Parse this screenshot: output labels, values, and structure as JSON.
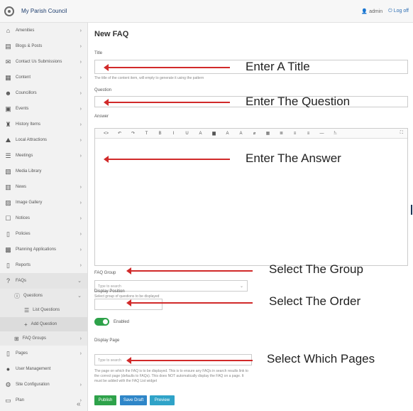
{
  "header": {
    "site_title": "My Parish Council",
    "user_label": "admin",
    "logout_label": "Log off"
  },
  "sidebar": {
    "items": [
      {
        "label": "Amenities",
        "icon": "amenities-icon"
      },
      {
        "label": "Blogs & Posts",
        "icon": "blog-icon"
      },
      {
        "label": "Contact Us Submissions",
        "icon": "mail-icon"
      },
      {
        "label": "Content",
        "icon": "content-icon"
      },
      {
        "label": "Councillors",
        "icon": "people-icon"
      },
      {
        "label": "Events",
        "icon": "calendar-icon"
      },
      {
        "label": "History Items",
        "icon": "history-icon"
      },
      {
        "label": "Local Attractions",
        "icon": "attractions-icon"
      },
      {
        "label": "Meetings",
        "icon": "meetings-icon"
      },
      {
        "label": "Media Library",
        "icon": "media-icon"
      },
      {
        "label": "News",
        "icon": "news-icon"
      },
      {
        "label": "Image Gallery",
        "icon": "gallery-icon"
      },
      {
        "label": "Notices",
        "icon": "notices-icon"
      },
      {
        "label": "Policies",
        "icon": "policies-icon"
      },
      {
        "label": "Planning Applications",
        "icon": "planning-icon"
      },
      {
        "label": "Reports",
        "icon": "reports-icon"
      }
    ],
    "faqs": {
      "label": "FAQs",
      "icon": "question-icon"
    },
    "questions": {
      "label": "Questions",
      "icon": "info-icon"
    },
    "list_questions": {
      "label": "List Questions",
      "icon": "list-icon"
    },
    "add_question": {
      "label": "Add Question",
      "icon": "plus-icon"
    },
    "faq_groups": {
      "label": "FAQ Groups",
      "icon": "groups-icon"
    },
    "bottom_items": [
      {
        "label": "Pages",
        "icon": "pages-icon"
      },
      {
        "label": "User Management",
        "icon": "user-icon"
      },
      {
        "label": "Site Configuration",
        "icon": "config-icon"
      },
      {
        "label": "Plan",
        "icon": "plan-icon"
      }
    ],
    "collapse_label": "«"
  },
  "form": {
    "page_title": "New FAQ",
    "title_label": "Title",
    "title_help": "The title of the content item, will empty to generate it using the pattern",
    "question_label": "Question",
    "answer_label": "Answer",
    "toolbar": [
      "<>",
      "↶",
      "↷",
      "T",
      "B",
      "I",
      "U",
      "A",
      "▆",
      "A",
      "A",
      "⌀",
      "▦",
      "≣",
      "≡",
      "≡",
      "—",
      "⎁"
    ],
    "toolbar_expand": "⛶",
    "faq_group_label": "FAQ Group",
    "faq_group_placeholder": "Type to search",
    "faq_group_help": "Select group of questions to be displayed",
    "display_position_label": "Display Position",
    "enabled_label": "Enabled",
    "display_page_label": "Display Page",
    "display_page_placeholder": "Type to search",
    "display_page_help": "The page on which the FAQ is to be displayed. This is to ensure any FAQs in search results link to the correct page (defaults to FAQs). This does NOT automatically display the FAQ on a page. It must be added with the FAQ List widget",
    "publish_label": "Publish",
    "save_draft_label": "Save Draft",
    "preview_label": "Preview"
  },
  "annotations": {
    "title": "Enter A Title",
    "question": "Enter The Question",
    "answer": "Enter The Answer",
    "group": "Select The Group",
    "order": "Select The Order",
    "pages": "Select Which Pages"
  },
  "colors": {
    "arrow": "#d12a2a",
    "publish": "#2ea24a",
    "save_draft": "#2f86c8",
    "preview": "#2fa3c8",
    "toggle_on": "#2ea24a"
  }
}
